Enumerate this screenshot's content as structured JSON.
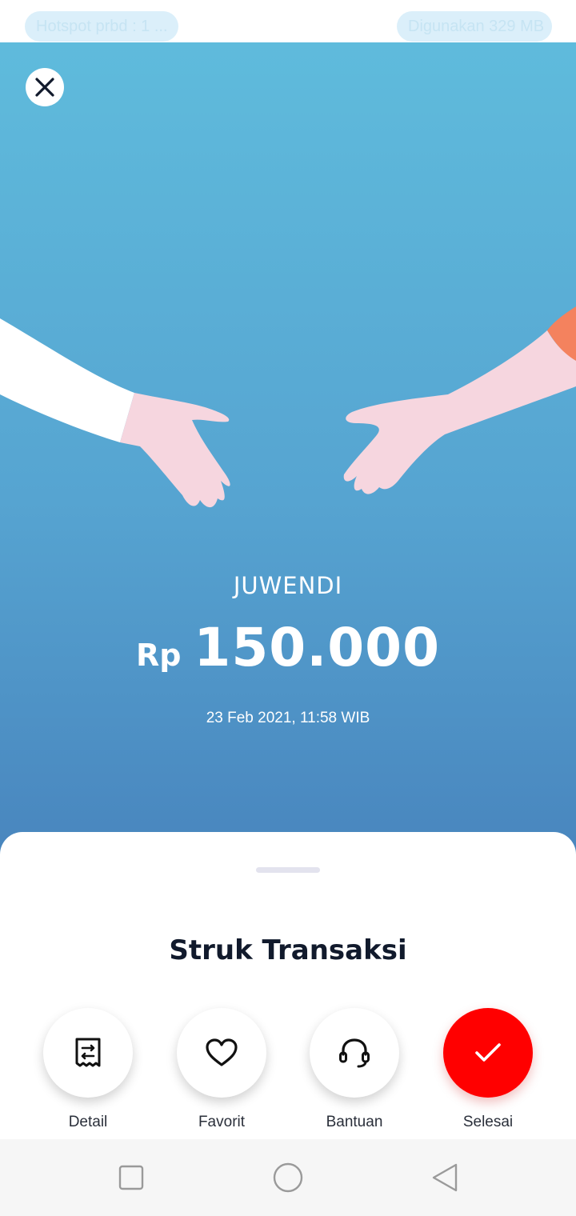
{
  "status": {
    "hotspot_text": "Hotspot prbd : 1 ...",
    "usage_text": "Digunakan 329 MB"
  },
  "hero": {
    "close_icon": "close-icon",
    "recipient": "JUWENDI",
    "currency": "Rp",
    "amount": "150.000",
    "datetime": "23 Feb 2021, 11:58 WIB"
  },
  "sheet": {
    "title": "Struk Transaksi",
    "actions": [
      {
        "label": "Detail",
        "icon": "receipt-icon"
      },
      {
        "label": "Favorit",
        "icon": "heart-icon"
      },
      {
        "label": "Bantuan",
        "icon": "headset-icon"
      },
      {
        "label": "Selesai",
        "icon": "check-icon"
      }
    ]
  },
  "navbar": {
    "icons": [
      "recent-apps-icon",
      "home-icon",
      "back-icon"
    ]
  },
  "colors": {
    "hero_top": "#5fbbdc",
    "hero_bottom": "#4884bd",
    "accent_red": "#ff0000",
    "title_text": "#111a2c"
  }
}
